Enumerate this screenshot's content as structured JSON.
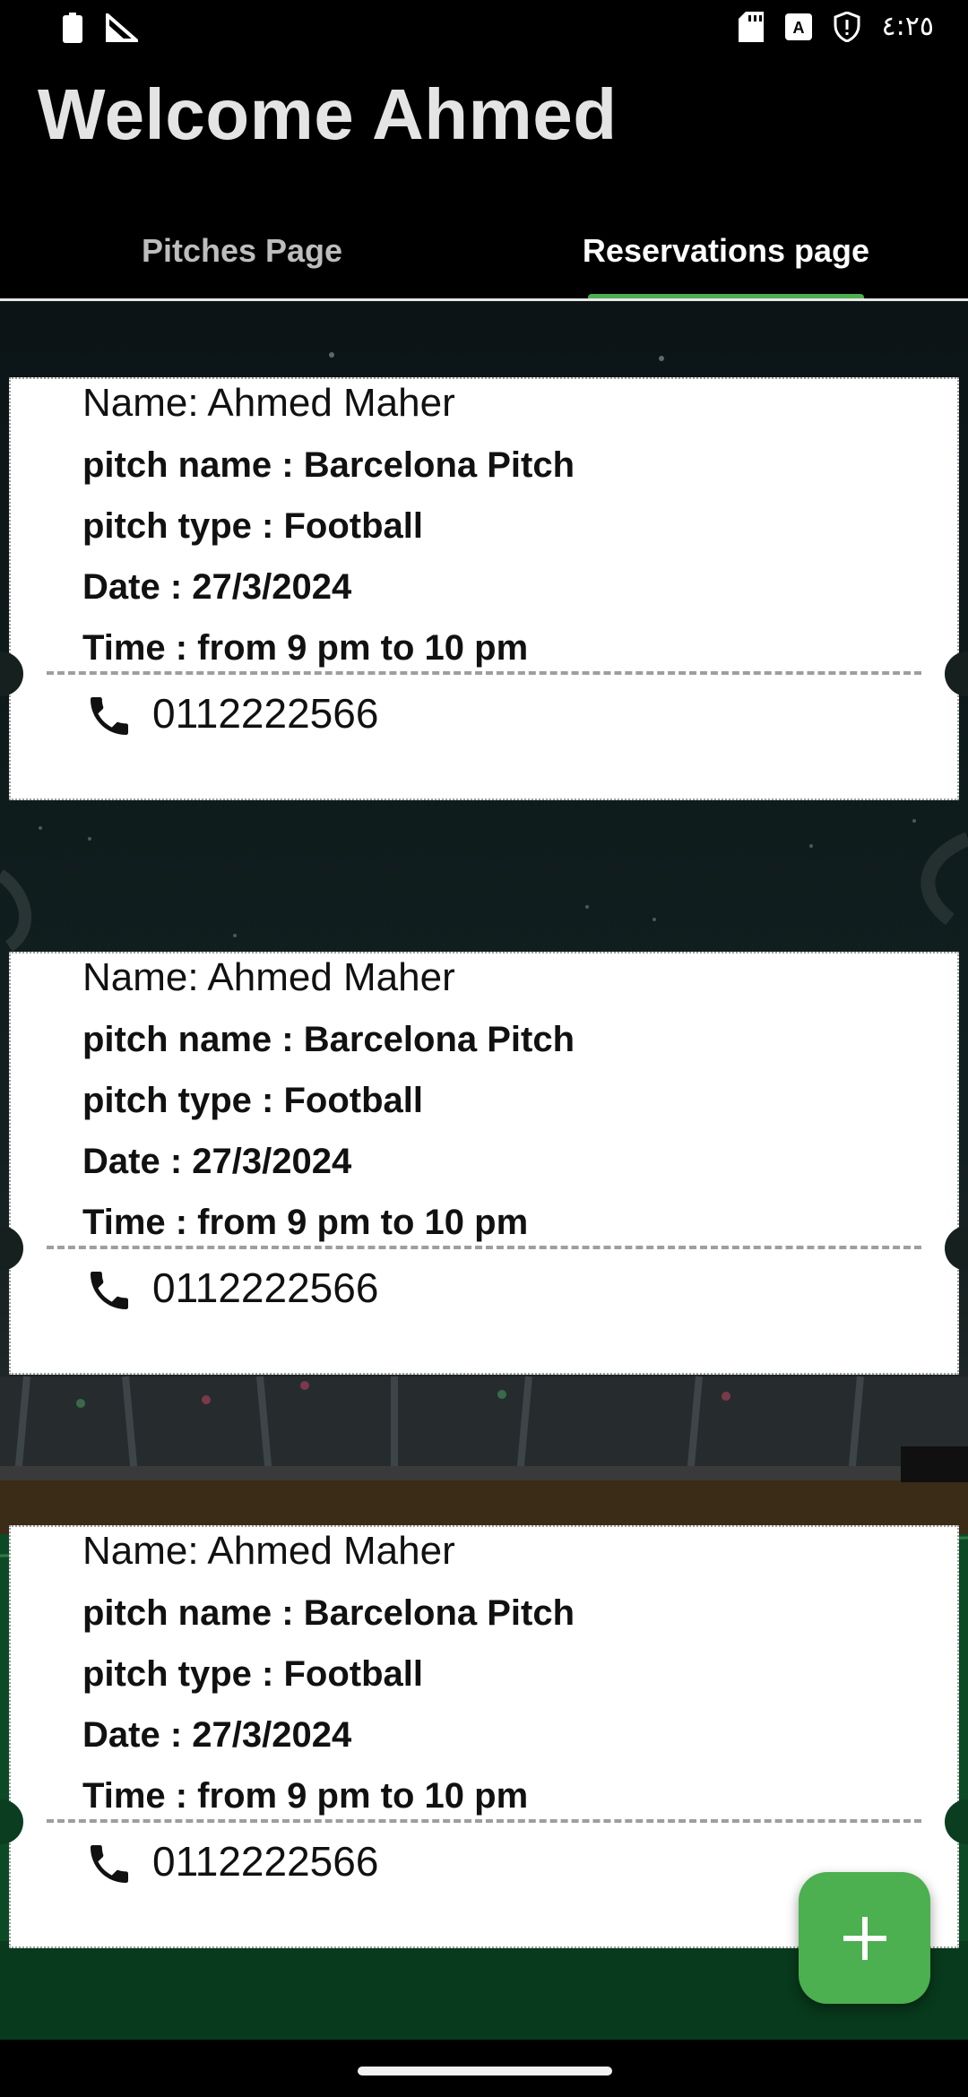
{
  "status_bar": {
    "time": "٤:٢٥",
    "left_icons": [
      "battery-icon",
      "signal-icon"
    ],
    "right_icons": [
      "sd-card-icon",
      "keyboard-a-icon",
      "shield-icon"
    ]
  },
  "header": {
    "title": "Welcome Ahmed"
  },
  "tabs": [
    {
      "label": "Pitches Page",
      "active": false
    },
    {
      "label": "Reservations page",
      "active": true
    }
  ],
  "colors": {
    "accent": "#4caf50",
    "background": "#000000",
    "card": "#ffffff"
  },
  "reservations": [
    {
      "name": "Name: Ahmed Maher",
      "pitch_name": "pitch name : Barcelona Pitch",
      "pitch_type": "pitch type : Football",
      "date": "Date : 27/3/2024",
      "time": "Time : from 9 pm to 10 pm",
      "phone": "0112222566"
    },
    {
      "name": "Name: Ahmed Maher",
      "pitch_name": "pitch name : Barcelona Pitch",
      "pitch_type": "pitch type : Football",
      "date": "Date : 27/3/2024",
      "time": "Time : from 9 pm to 10 pm",
      "phone": "0112222566"
    },
    {
      "name": "Name: Ahmed Maher",
      "pitch_name": "pitch name : Barcelona Pitch",
      "pitch_type": "pitch type : Football",
      "date": "Date : 27/3/2024",
      "time": "Time : from 9 pm to 10 pm",
      "phone": "0112222566"
    }
  ],
  "fab": {
    "icon": "plus-icon"
  }
}
